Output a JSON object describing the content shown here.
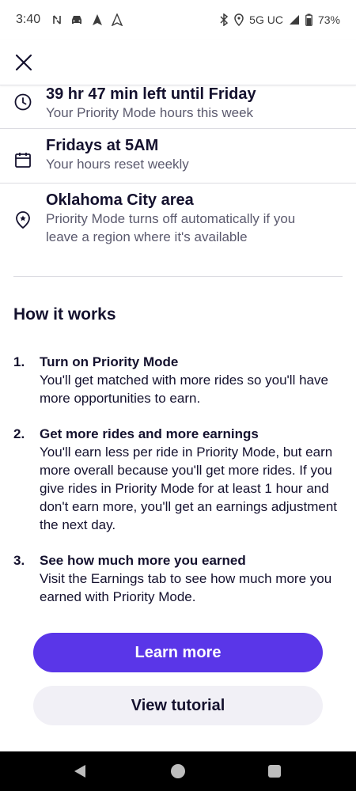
{
  "status_bar": {
    "time": "3:40",
    "network": "5G UC",
    "battery": "73%",
    "icons": [
      "nfc-icon",
      "car-icon",
      "navigation-icon",
      "navigation-outline-icon",
      "bluetooth-icon",
      "location-icon",
      "signal-icon",
      "battery-icon"
    ]
  },
  "header": {
    "close_icon": "close-icon"
  },
  "info_rows": [
    {
      "icon": "clock-icon",
      "title": "39 hr 47 min left until Friday",
      "subtitle": "Your Priority Mode hours this week"
    },
    {
      "icon": "calendar-icon",
      "title": "Fridays at 5AM",
      "subtitle": "Your hours reset weekly"
    },
    {
      "icon": "location-star-icon",
      "title": "Oklahoma City area",
      "subtitle": "Priority Mode turns off automatically if you leave a region where it's available"
    }
  ],
  "how_it_works": {
    "title": "How it works",
    "steps": [
      {
        "number": "1.",
        "title": "Turn on Priority Mode",
        "description": "You'll get matched with more rides so you'll have more opportunities to earn."
      },
      {
        "number": "2.",
        "title": "Get more rides and more earnings",
        "description": "You'll earn less per ride in Priority Mode, but earn more overall because you'll get more rides. If you give rides in Priority Mode for at least 1 hour and don't earn more, you'll get an earnings adjustment the next day."
      },
      {
        "number": "3.",
        "title": "See how much more you earned",
        "description": "Visit the Earnings tab to see how much more you earned with Priority Mode."
      }
    ]
  },
  "buttons": {
    "primary": "Learn more",
    "secondary": "View tutorial"
  },
  "colors": {
    "primary": "#5a36e8",
    "secondary_bg": "#f1f0f6",
    "text": "#14112e",
    "muted_text": "#5b5a6e"
  }
}
